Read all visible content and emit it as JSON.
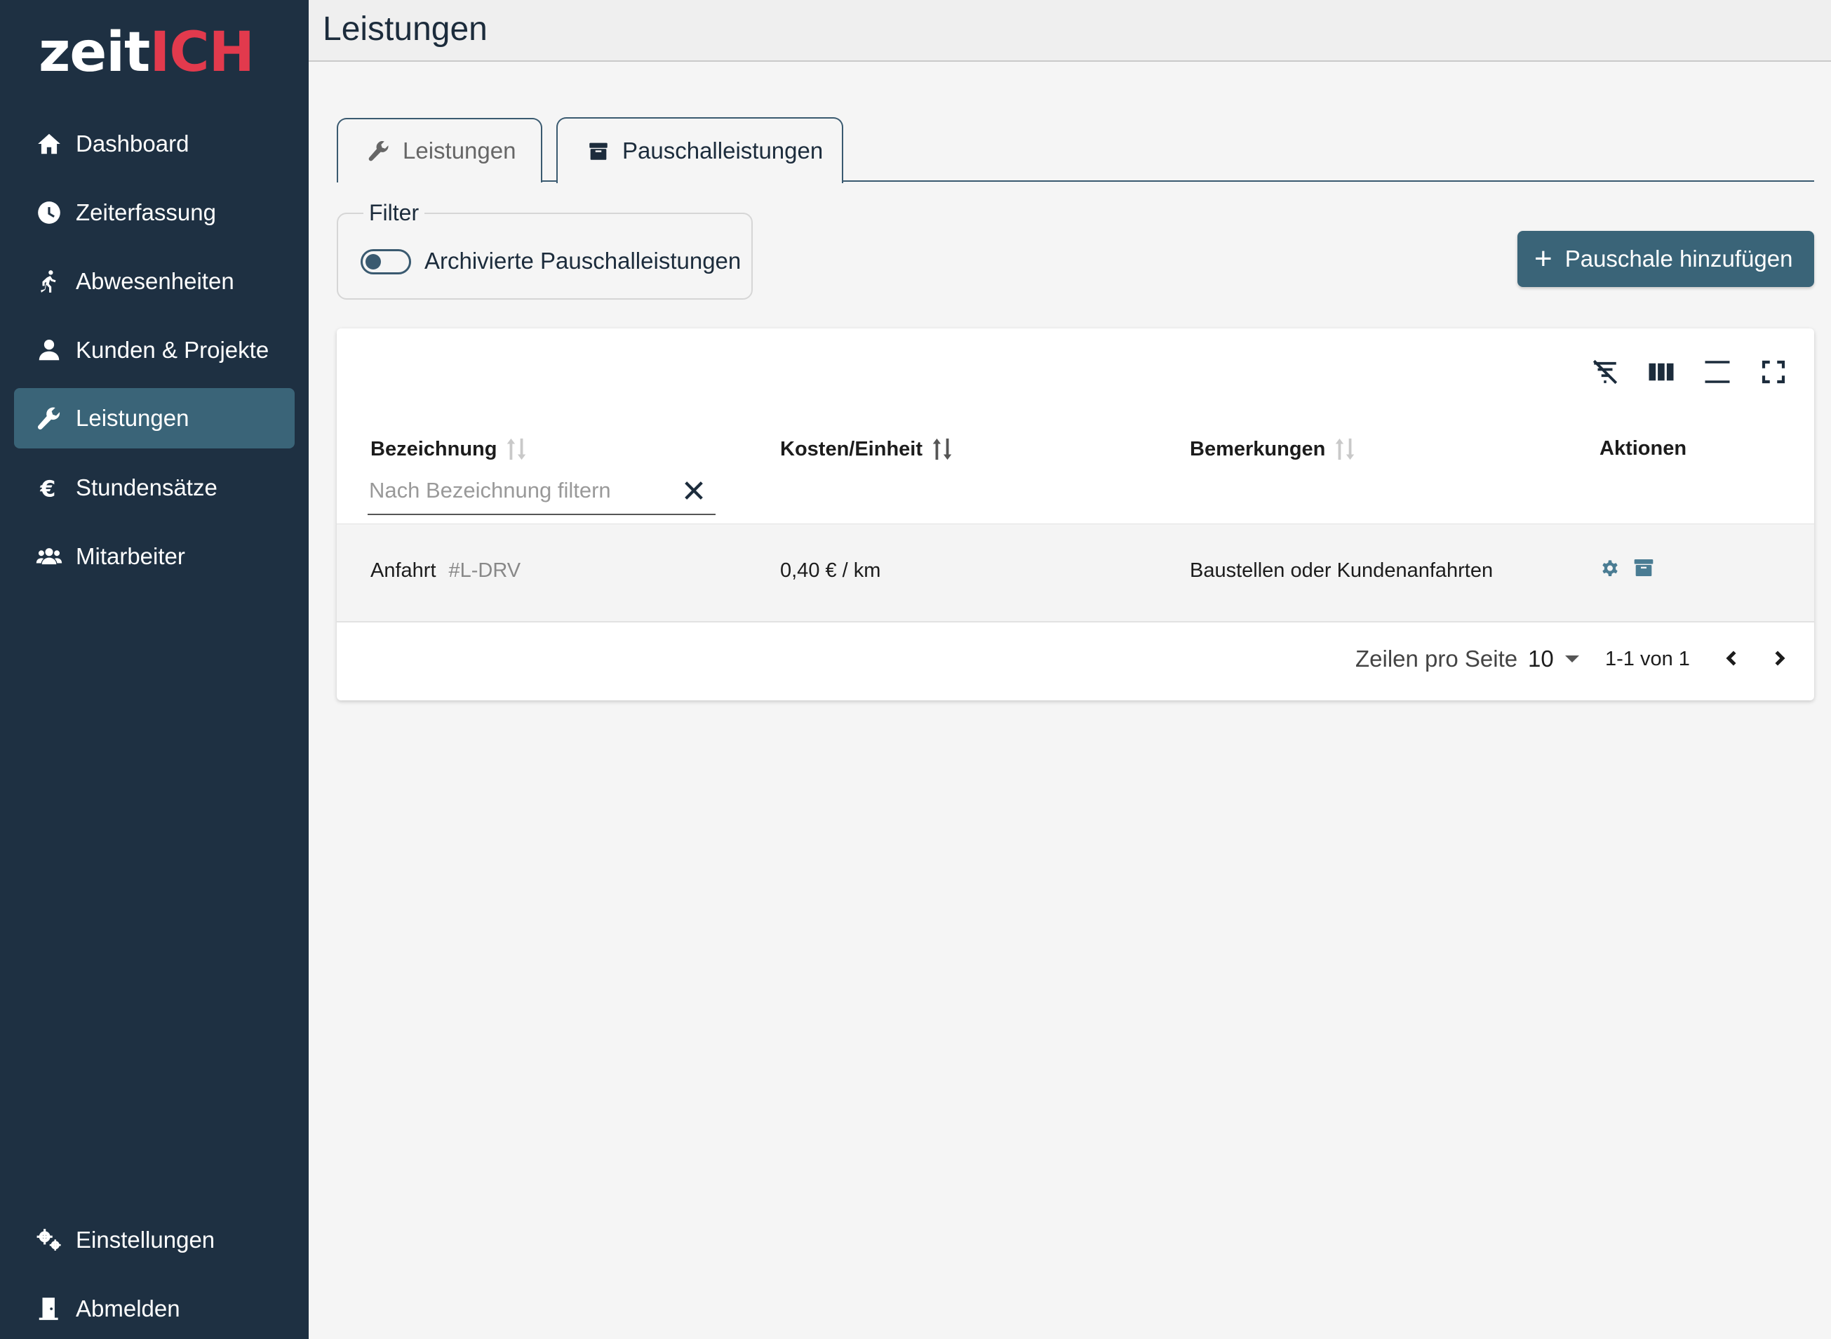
{
  "app": {
    "logo_part1": "zeit",
    "logo_part2": "ICH"
  },
  "sidebar": {
    "items": [
      {
        "label": "Dashboard",
        "icon": "home-icon"
      },
      {
        "label": "Zeiterfassung",
        "icon": "clock-icon"
      },
      {
        "label": "Abwesenheiten",
        "icon": "walking-icon"
      },
      {
        "label": "Kunden & Projekte",
        "icon": "user-icon"
      },
      {
        "label": "Leistungen",
        "icon": "wrench-icon",
        "active": true
      },
      {
        "label": "Stundensätze",
        "icon": "euro-icon"
      },
      {
        "label": "Mitarbeiter",
        "icon": "users-icon"
      }
    ],
    "bottom_items": [
      {
        "label": "Einstellungen",
        "icon": "gears-icon"
      },
      {
        "label": "Abmelden",
        "icon": "door-icon"
      }
    ]
  },
  "header": {
    "title": "Leistungen"
  },
  "tabs": [
    {
      "label": "Leistungen",
      "icon": "wrench-icon",
      "active": false
    },
    {
      "label": "Pauschalleistungen",
      "icon": "box-icon",
      "active": true
    }
  ],
  "filter": {
    "legend": "Filter",
    "toggle_label": "Archivierte Pauschalleistungen",
    "toggle_on": false
  },
  "add_button": {
    "label": "Pauschale hinzufügen"
  },
  "table": {
    "toolbar_icons": [
      "filter-off-icon",
      "columns-icon",
      "density-icon",
      "fullscreen-icon"
    ],
    "columns": {
      "name": "Bezeichnung",
      "cost": "Kosten/Einheit",
      "notes": "Bemerkungen",
      "actions": "Aktionen"
    },
    "name_filter_placeholder": "Nach Bezeichnung filtern",
    "rows": [
      {
        "name": "Anfahrt",
        "code": "#L-DRV",
        "cost": "0,40 € / km",
        "notes": "Baustellen oder Kundenanfahrten"
      }
    ],
    "pagination": {
      "rows_per_page_label": "Zeilen pro Seite",
      "rows_per_page": "10",
      "range": "1-1 von 1"
    }
  },
  "colors": {
    "sidebar_bg": "#1e3042",
    "accent": "#3a6478",
    "logo_red": "#e23a4d",
    "action_icon": "#4a7c93"
  }
}
